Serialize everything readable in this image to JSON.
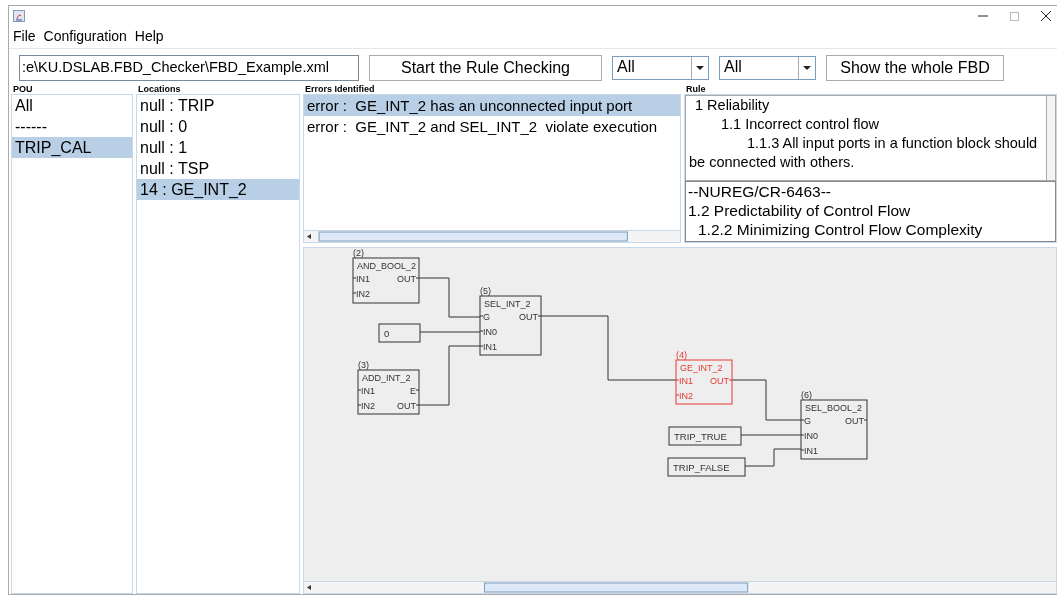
{
  "menu": [
    "File",
    "Configuration",
    "Help"
  ],
  "toolbar": {
    "path": ":e\\KU.DSLAB.FBD_Checker\\FBD_Example.xml",
    "start_button": "Start the Rule Checking",
    "filters": [
      "All",
      "All"
    ],
    "show_button": "Show the whole FBD"
  },
  "pou": {
    "title": "POU",
    "items": [
      {
        "label": "All",
        "selected": false
      },
      {
        "label": "------",
        "selected": false
      },
      {
        "label": "TRIP_CAL",
        "selected": true
      }
    ]
  },
  "locations": {
    "title": "Locations",
    "items": [
      {
        "label": "null : TRIP",
        "selected": false
      },
      {
        "label": "null : 0",
        "selected": false
      },
      {
        "label": "null : 1",
        "selected": false
      },
      {
        "label": "null : TSP",
        "selected": false
      },
      {
        "label": "14 : GE_INT_2",
        "selected": true
      }
    ]
  },
  "errors": {
    "title": "Errors Identified",
    "items": [
      {
        "label": "error :  GE_INT_2 has an unconnected input port",
        "selected": true
      },
      {
        "label": "error :  GE_INT_2 and SEL_INT_2  violate execution",
        "selected": false
      }
    ]
  },
  "rule": {
    "title": "Rule",
    "items": [
      {
        "text": "1  Reliability",
        "children": [
          {
            "text": "1.1  Incorrect control flow",
            "children": [
              {
                "text": "1.1.3 All input ports in a function block should be connected with others."
              }
            ]
          }
        ]
      }
    ],
    "reference": [
      {
        "text": "--NUREG/CR-6463--"
      },
      {
        "text": "1.2 Predictability of Control Flow",
        "children": [
          {
            "text": "1.2.2 Minimizing Control Flow Complexity"
          }
        ]
      }
    ]
  },
  "diagram": {
    "blocks": [
      {
        "kind": "block",
        "number": "(2)",
        "name": "AND_BOOL_2",
        "inputs": [
          "IN1",
          "IN2"
        ],
        "outputs": [
          "OUT"
        ],
        "error": false
      },
      {
        "kind": "constant",
        "name": "0"
      },
      {
        "kind": "block",
        "number": "(5)",
        "name": "SEL_INT_2",
        "inputs": [
          "G",
          "IN0",
          "IN1"
        ],
        "outputs": [
          "OUT"
        ],
        "error": false
      },
      {
        "kind": "block",
        "number": "(3)",
        "name": "ADD_INT_2",
        "inputs": [
          "IN1",
          "IN2"
        ],
        "outputs": [
          "E",
          "OUT"
        ],
        "error": false
      },
      {
        "kind": "block",
        "number": "(4)",
        "name": "GE_INT_2",
        "inputs": [
          "IN1",
          "IN2"
        ],
        "outputs": [
          "OUT"
        ],
        "error": true
      },
      {
        "kind": "constant",
        "name": "TRIP_TRUE"
      },
      {
        "kind": "constant",
        "name": "TRIP_FALSE"
      },
      {
        "kind": "block",
        "number": "(6)",
        "name": "SEL_BOOL_2",
        "inputs": [
          "G",
          "IN0",
          "IN1"
        ],
        "outputs": [
          "OUT"
        ],
        "error": false
      }
    ]
  }
}
